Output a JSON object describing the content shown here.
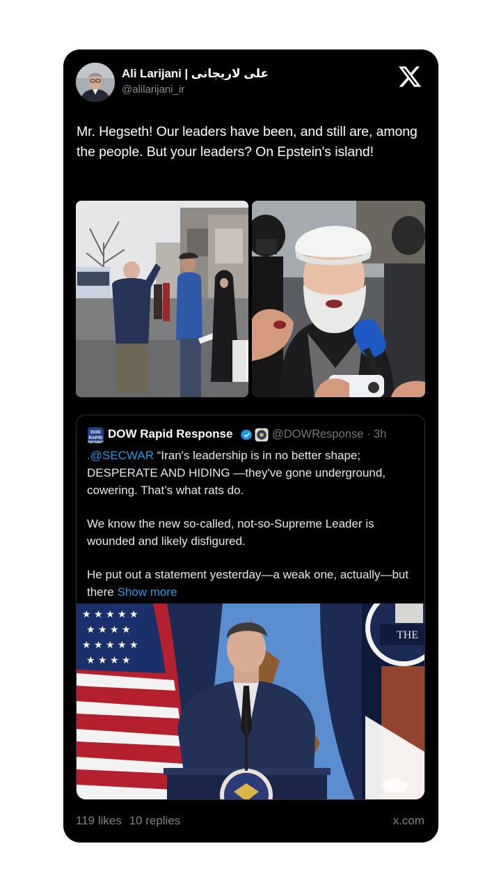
{
  "tweet": {
    "author": {
      "name": "Ali Larijani | علی لاریجانی",
      "handle": "@alilarijani_ir"
    },
    "text": "Mr. Hegseth! Our leaders have been, and still are, among the people. But your leaders? On Epstein's island!",
    "brand_icon": "x-logo-icon"
  },
  "quoted_tweet": {
    "logo_text": "DOD RAPID RESPONSE",
    "author_name": "DOW Rapid Response",
    "handle_time": "@DOWResponse · 3h",
    "mention": ".@SECWAR",
    "paragraph1_text": " “Iran's leadership is in no better shape; DESPERATE AND HIDING —they've gone underground, cowering. That’s what rats do.",
    "paragraph2": "We know the new so-called, not-so-Supreme Leader is wounded and likely disfigured.",
    "paragraph3_text": "He put out a statement yesterday—a weak one, actually—but there ",
    "show_more": "Show more",
    "video_overlay_text": "THE"
  },
  "footer": {
    "likes": "119 likes",
    "replies": "10 replies",
    "domain": "x.com"
  },
  "colors": {
    "card_bg": "#000000",
    "link": "#1d9bf0",
    "verified": "#1d9bf0",
    "muted": "#71767b"
  }
}
